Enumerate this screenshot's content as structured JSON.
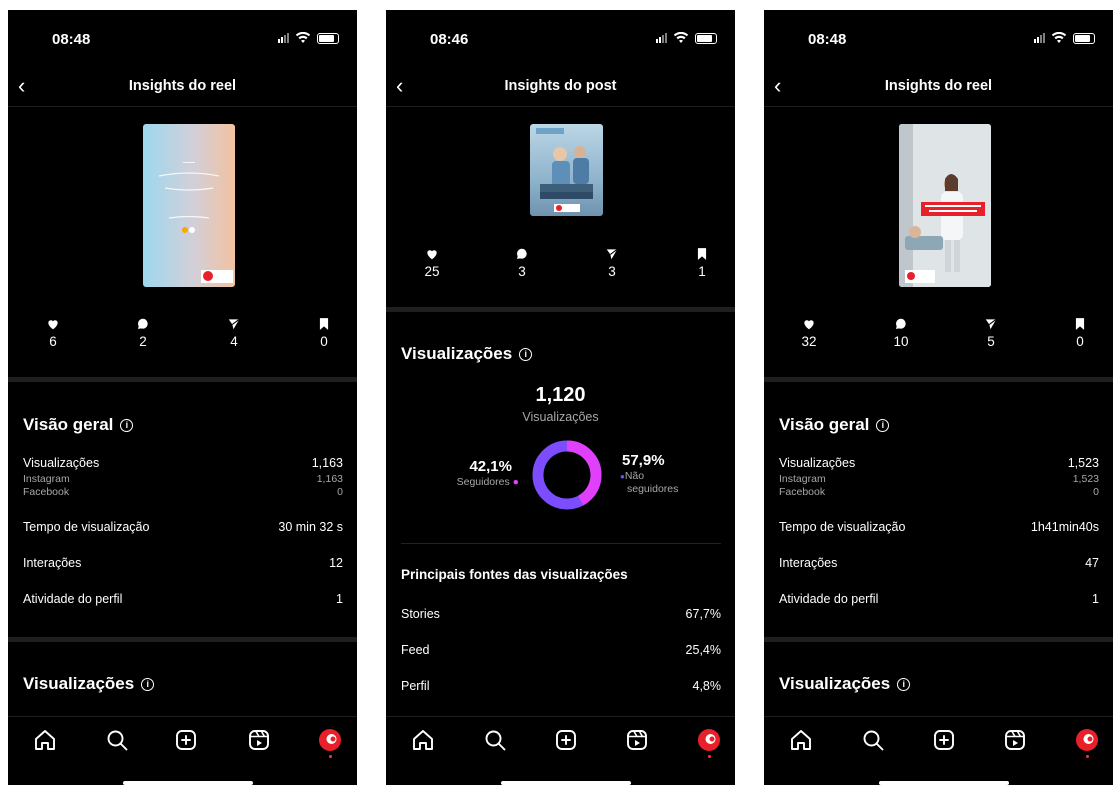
{
  "icon_names": [
    "heart-icon",
    "comment-icon",
    "share-icon",
    "bookmark-icon",
    "home-icon",
    "search-icon",
    "create-icon",
    "reels-icon",
    "profile-avatar"
  ],
  "colors": {
    "background": "#000000",
    "followers": "#e040fb",
    "non_followers": "#7c4dff",
    "muted": "#a8a8a8"
  },
  "screen1": {
    "time": "08:48",
    "title": "Insights do reel",
    "stats": {
      "likes": "6",
      "comments": "2",
      "shares": "4",
      "saves": "0"
    },
    "overview": {
      "heading": "Visão geral",
      "views_label": "Visualizações",
      "views_value": "1,163",
      "instagram_label": "Instagram",
      "instagram_value": "1,163",
      "facebook_label": "Facebook",
      "facebook_value": "0",
      "watch_time_label": "Tempo de visualização",
      "watch_time_value": "30 min 32 s",
      "interactions_label": "Interações",
      "interactions_value": "12",
      "profile_activity_label": "Atividade do perfil",
      "profile_activity_value": "1"
    },
    "views_heading": "Visualizações"
  },
  "screen2": {
    "time": "08:46",
    "title": "Insights do post",
    "stats": {
      "likes": "25",
      "comments": "3",
      "shares": "3",
      "saves": "1"
    },
    "views_heading": "Visualizações",
    "total_views": "1,120",
    "total_views_label": "Visualizações",
    "followers_pct": "42,1%",
    "followers_label": "Seguidores",
    "non_followers_pct": "57,9%",
    "non_followers_label_1": "Não",
    "non_followers_label_2": "seguidores",
    "sources_heading": "Principais fontes das visualizações",
    "sources": [
      {
        "label": "Stories",
        "value": "67,7%"
      },
      {
        "label": "Feed",
        "value": "25,4%"
      },
      {
        "label": "Perfil",
        "value": "4,8%"
      }
    ]
  },
  "screen3": {
    "time": "08:48",
    "title": "Insights do reel",
    "stats": {
      "likes": "32",
      "comments": "10",
      "shares": "5",
      "saves": "0"
    },
    "overview": {
      "heading": "Visão geral",
      "views_label": "Visualizações",
      "views_value": "1,523",
      "instagram_label": "Instagram",
      "instagram_value": "1,523",
      "facebook_label": "Facebook",
      "facebook_value": "0",
      "watch_time_label": "Tempo de visualização",
      "watch_time_value": "1h41min40s",
      "interactions_label": "Interações",
      "interactions_value": "47",
      "profile_activity_label": "Atividade do perfil",
      "profile_activity_value": "1"
    },
    "views_heading": "Visualizações"
  }
}
